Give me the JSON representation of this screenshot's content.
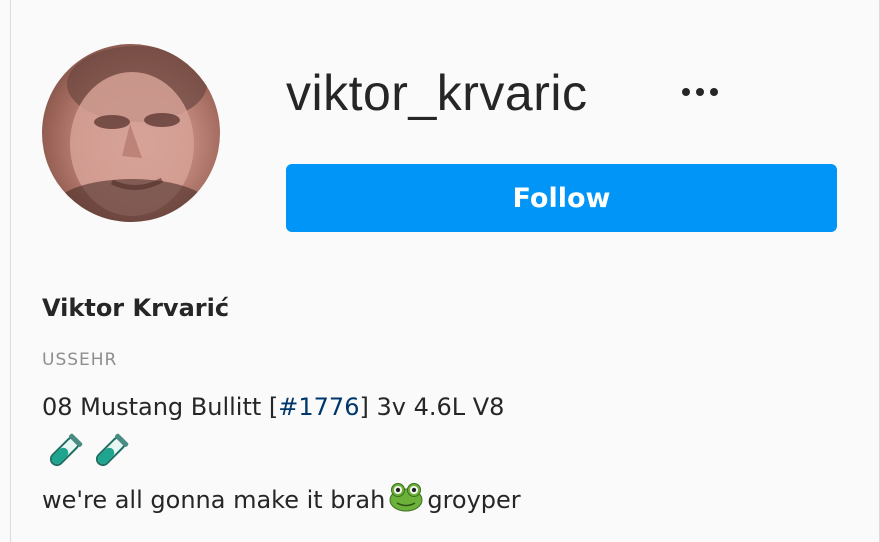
{
  "profile": {
    "username": "viktor_krvaric",
    "follow_label": "Follow",
    "full_name": "Viktor Krvarić",
    "category": "USSEHR",
    "bio": {
      "line1_prefix": "08 Mustang Bullitt [",
      "line1_hashtag": "#1776",
      "line1_suffix": "] 3v 4.6L V8",
      "line3_before": "we're all gonna make it brah",
      "line3_after": "groyper"
    }
  },
  "icons": {
    "more": "more-options-icon",
    "vial": "test-tube-icon",
    "frog": "frog-face-icon"
  },
  "colors": {
    "accent": "#0095f6",
    "hashtag": "#00376b",
    "muted": "#8e8e8e",
    "text": "#262626"
  }
}
